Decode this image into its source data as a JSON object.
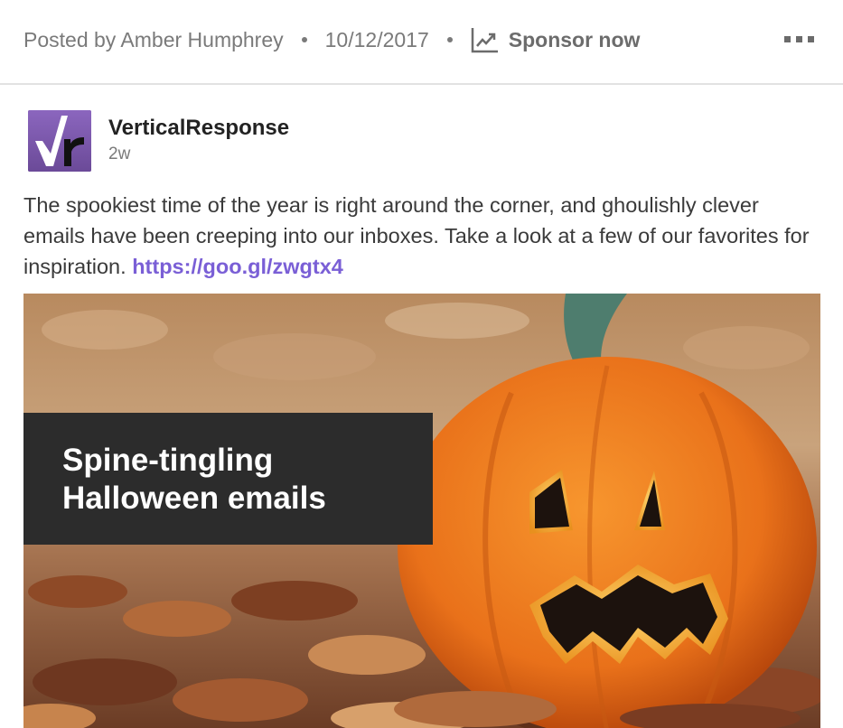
{
  "header": {
    "posted_by": "Posted by Amber Humphrey",
    "date": "10/12/2017",
    "sponsor_label": "Sponsor now",
    "sponsor_icon": "trending-up-icon",
    "more_icon": "more-options-icon"
  },
  "post": {
    "company_name": "VerticalResponse",
    "age": "2w",
    "text": "The spookiest time of the year is right around the corner, and ghoulishly clever emails have been creeping into our inboxes. Take a look at a few of our favorites for inspiration.",
    "link": "https://goo.gl/zwgtx4",
    "image_caption": "Spine-tingling\nHalloween emails"
  },
  "colors": {
    "logo_purple": "#7b5aa8",
    "link_purple": "#7a5fd6",
    "caption_box": "#2c2c2c"
  }
}
